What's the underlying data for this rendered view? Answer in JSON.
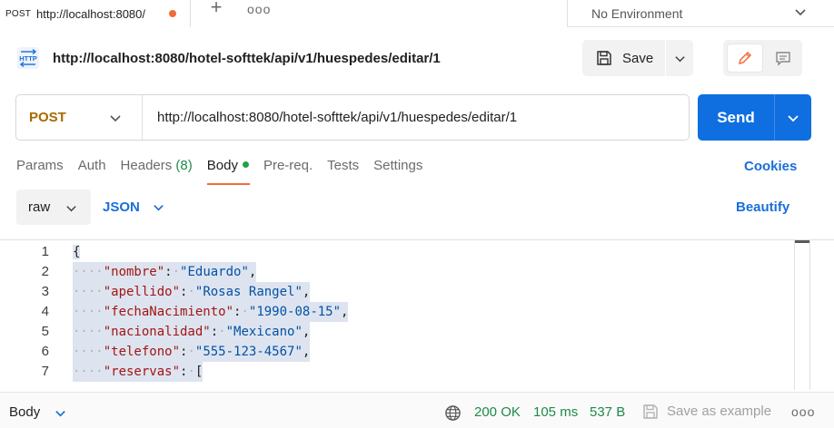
{
  "tab": {
    "method": "POST",
    "title": "http://localhost:8080/",
    "unsaved": true
  },
  "tabstrip": {
    "add_icon": "plus-icon",
    "more": "ooo"
  },
  "environment": {
    "label": "No Environment"
  },
  "request": {
    "title": "http://localhost:8080/hotel-softtek/api/v1/huespedes/editar/1"
  },
  "save": {
    "label": "Save"
  },
  "urlbar": {
    "method": "POST",
    "url": "http://localhost:8080/hotel-softtek/api/v1/huespedes/editar/1"
  },
  "send": {
    "label": "Send"
  },
  "subtabs": [
    {
      "label": "Params"
    },
    {
      "label": "Auth"
    },
    {
      "label": "Headers",
      "count": "(8)"
    },
    {
      "label": "Body",
      "active": true
    },
    {
      "label": "Pre-req."
    },
    {
      "label": "Tests"
    },
    {
      "label": "Settings"
    }
  ],
  "cookies_label": "Cookies",
  "body_options": {
    "mode": "raw",
    "language": "JSON",
    "beautify": "Beautify"
  },
  "editor": {
    "lines": [
      {
        "n": "1"
      },
      {
        "n": "2",
        "key": "\"nombre\"",
        "value": "\"Eduardo\"",
        "trail": ","
      },
      {
        "n": "3",
        "key": "\"apellido\"",
        "value": "\"Rosas Rangel\"",
        "trail": ","
      },
      {
        "n": "4",
        "key": "\"fechaNacimiento\"",
        "value": "\"1990-08-15\"",
        "trail": ","
      },
      {
        "n": "5",
        "key": "\"nacionalidad\"",
        "value": "\"Mexicano\"",
        "trail": ","
      },
      {
        "n": "6",
        "key": "\"telefono\"",
        "value": "\"555-123-4567\"",
        "trail": ","
      },
      {
        "n": "7",
        "key": "\"reservas\"",
        "value": "[",
        "trail": ""
      }
    ],
    "open_brace": "{"
  },
  "footer": {
    "body_label": "Body",
    "status": "200 OK",
    "time": "105 ms",
    "size": "537 B",
    "save_example": "Save as example",
    "more": "ooo"
  },
  "colors": {
    "accent": "#0f6fe0",
    "method": "#a56a00",
    "success": "#1e8a4a",
    "tab_dot": "#f26b3a"
  }
}
